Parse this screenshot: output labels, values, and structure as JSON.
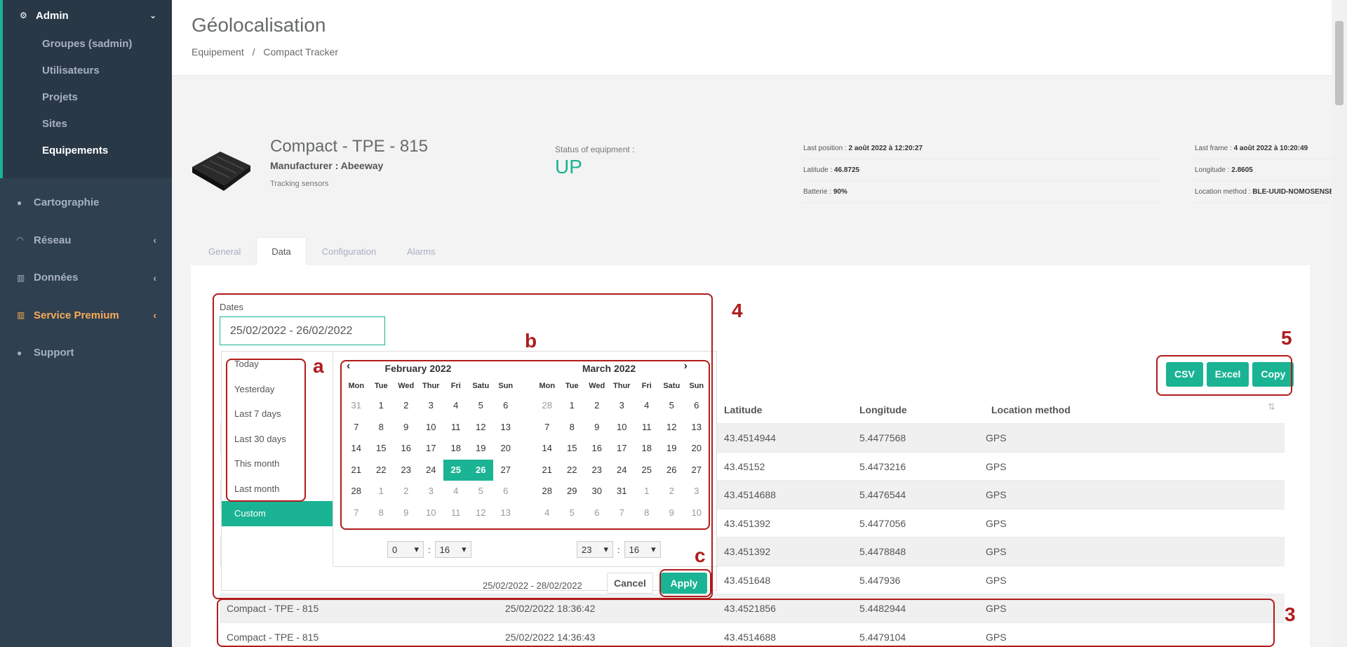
{
  "sidebar": {
    "admin": {
      "label": "Admin",
      "items": [
        "Groupes (sadmin)",
        "Utilisateurs",
        "Projets",
        "Sites",
        "Equipements"
      ]
    },
    "nav": [
      {
        "label": "Cartographie",
        "icon": "globe-icon"
      },
      {
        "label": "Réseau",
        "icon": "wifi-icon"
      },
      {
        "label": "Données",
        "icon": "bar-chart-icon"
      },
      {
        "label": "Service Premium",
        "icon": "bar-chart-icon"
      },
      {
        "label": "Support",
        "icon": "question-circle-icon"
      }
    ]
  },
  "page": {
    "title": "Géolocalisation",
    "breadcrumb": [
      "Equipement",
      "/",
      "Compact Tracker"
    ]
  },
  "equipment": {
    "name": "Compact - TPE - 815",
    "manufacturer": "Manufacturer : Abeeway",
    "category": "Tracking sensors",
    "status_label": "Status of equipment :",
    "status_value": "UP"
  },
  "info": {
    "last_position_label": "Last position : ",
    "last_position": "2 août 2022 à 12:20:27",
    "latitude_label": "Latitude : ",
    "latitude": "46.8725",
    "battery_label": "Batterie : ",
    "battery": "90%",
    "last_frame_label": "Last frame : ",
    "last_frame": "4 août 2022 à 10:20:49",
    "longitude_label": "Longitude : ",
    "longitude": "2.8605",
    "method_label": "Location method : ",
    "method": "BLE-UUID-NOMOSENSE"
  },
  "tabs": [
    "General",
    "Data",
    "Configuration",
    "Alarms"
  ],
  "dates": {
    "label": "Dates",
    "value": "25/02/2022 - 26/02/2022"
  },
  "export": [
    "CSV",
    "Excel",
    "Copy"
  ],
  "table": {
    "headers": [
      "Latitude",
      "Longitude",
      "Location method"
    ],
    "rows": [
      [
        "",
        "",
        "43.4514944",
        "5.4477568",
        "GPS"
      ],
      [
        "",
        "",
        "43.45152",
        "5.4473216",
        "GPS"
      ],
      [
        "",
        "",
        "43.4514688",
        "5.4476544",
        "GPS"
      ],
      [
        "",
        "",
        "43.451392",
        "5.4477056",
        "GPS"
      ],
      [
        "",
        "",
        "43.451392",
        "5.4478848",
        "GPS"
      ],
      [
        "",
        "",
        "43.451648",
        "5.447936",
        "GPS"
      ],
      [
        "Compact - TPE - 815",
        "25/02/2022 18:36:42",
        "43.4521856",
        "5.4482944",
        "GPS"
      ],
      [
        "Compact - TPE - 815",
        "25/02/2022 14:36:43",
        "43.4514688",
        "5.4479104",
        "GPS"
      ]
    ]
  },
  "datepicker": {
    "ranges": [
      "Today",
      "Yesterday",
      "Last 7 days",
      "Last 30 days",
      "This month",
      "Last month",
      "Custom"
    ],
    "dow": [
      "Mon",
      "Tue",
      "Wed",
      "Thur",
      "Fri",
      "Satu",
      "Sun"
    ],
    "left": {
      "title": "February 2022",
      "days": [
        "31",
        "1",
        "2",
        "3",
        "4",
        "5",
        "6",
        "7",
        "8",
        "9",
        "10",
        "11",
        "12",
        "13",
        "14",
        "15",
        "16",
        "17",
        "18",
        "19",
        "20",
        "21",
        "22",
        "23",
        "24",
        "25",
        "26",
        "27",
        "28",
        "1",
        "2",
        "3",
        "4",
        "5",
        "6",
        "7",
        "8",
        "9",
        "10",
        "11",
        "12",
        "13"
      ]
    },
    "right": {
      "title": "March 2022",
      "days": [
        "28",
        "1",
        "2",
        "3",
        "4",
        "5",
        "6",
        "7",
        "8",
        "9",
        "10",
        "11",
        "12",
        "13",
        "14",
        "15",
        "16",
        "17",
        "18",
        "19",
        "20",
        "21",
        "22",
        "23",
        "24",
        "25",
        "26",
        "27",
        "28",
        "29",
        "30",
        "31",
        "1",
        "2",
        "3",
        "4",
        "5",
        "6",
        "7",
        "8",
        "9",
        "10"
      ]
    },
    "left_time": {
      "hour": "0",
      "minute": "16"
    },
    "right_time": {
      "hour": "23",
      "minute": "16"
    },
    "selected_range_text": "25/02/2022 - 28/02/2022",
    "cancel": "Cancel",
    "apply": "Apply"
  },
  "annotations": [
    "4",
    "a",
    "b",
    "c",
    "5",
    "3"
  ],
  "colors": {
    "accent": "#1ab394",
    "sidebar": "#2f4050",
    "premium": "#f8ac59",
    "annotation": "#b01b1b"
  }
}
